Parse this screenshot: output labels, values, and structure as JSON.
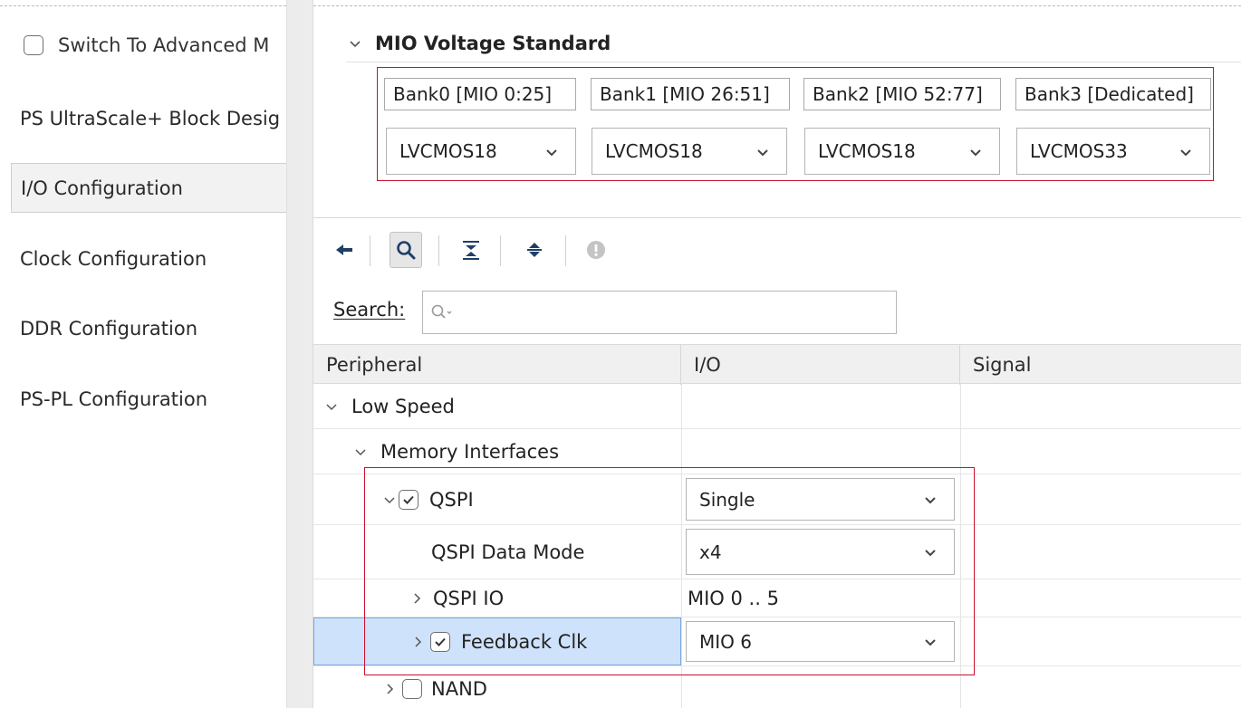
{
  "left_panel": {
    "advanced_mode_label": "Switch To Advanced M",
    "nav_items": [
      {
        "label": "PS UltraScale+ Block Desig"
      },
      {
        "label": "I/O Configuration"
      },
      {
        "label": "Clock Configuration"
      },
      {
        "label": "DDR Configuration"
      },
      {
        "label": "PS-PL Configuration"
      }
    ],
    "selected_index": 1
  },
  "mio_voltage": {
    "title": "MIO Voltage Standard",
    "banks": [
      {
        "label": "Bank0 [MIO 0:25]",
        "value": "LVCMOS18"
      },
      {
        "label": "Bank1 [MIO 26:51]",
        "value": "LVCMOS18"
      },
      {
        "label": "Bank2 [MIO 52:77]",
        "value": "LVCMOS18"
      },
      {
        "label": "Bank3 [Dedicated]",
        "value": "LVCMOS33"
      }
    ]
  },
  "toolbar": {
    "buttons": [
      "back-arrow-icon",
      "search-icon",
      "collapse-all-icon",
      "expand-all-icon",
      "info-icon"
    ],
    "active": "search-icon"
  },
  "search": {
    "label": "Search:",
    "placeholder": "",
    "value": ""
  },
  "table": {
    "columns": [
      "Peripheral",
      "I/O",
      "Signal"
    ],
    "rows": [
      {
        "label": "Low Speed",
        "io": "",
        "signal": ""
      },
      {
        "label": "Memory Interfaces",
        "io": "",
        "signal": ""
      },
      {
        "label": "QSPI",
        "io": "Single",
        "signal": "",
        "checked": true
      },
      {
        "label": "QSPI Data Mode",
        "io": "x4",
        "signal": ""
      },
      {
        "label": "QSPI IO",
        "io": "MIO 0 .. 5",
        "signal": ""
      },
      {
        "label": "Feedback Clk",
        "io": "MIO 6",
        "signal": "",
        "checked": true,
        "selected": true
      },
      {
        "label": "NAND",
        "io": "",
        "signal": "",
        "checked": false
      }
    ]
  },
  "colors": {
    "highlight_border": "#c8102e",
    "row_selection": "#cfe2fb",
    "toolbar_icon": "#1f3f66"
  }
}
